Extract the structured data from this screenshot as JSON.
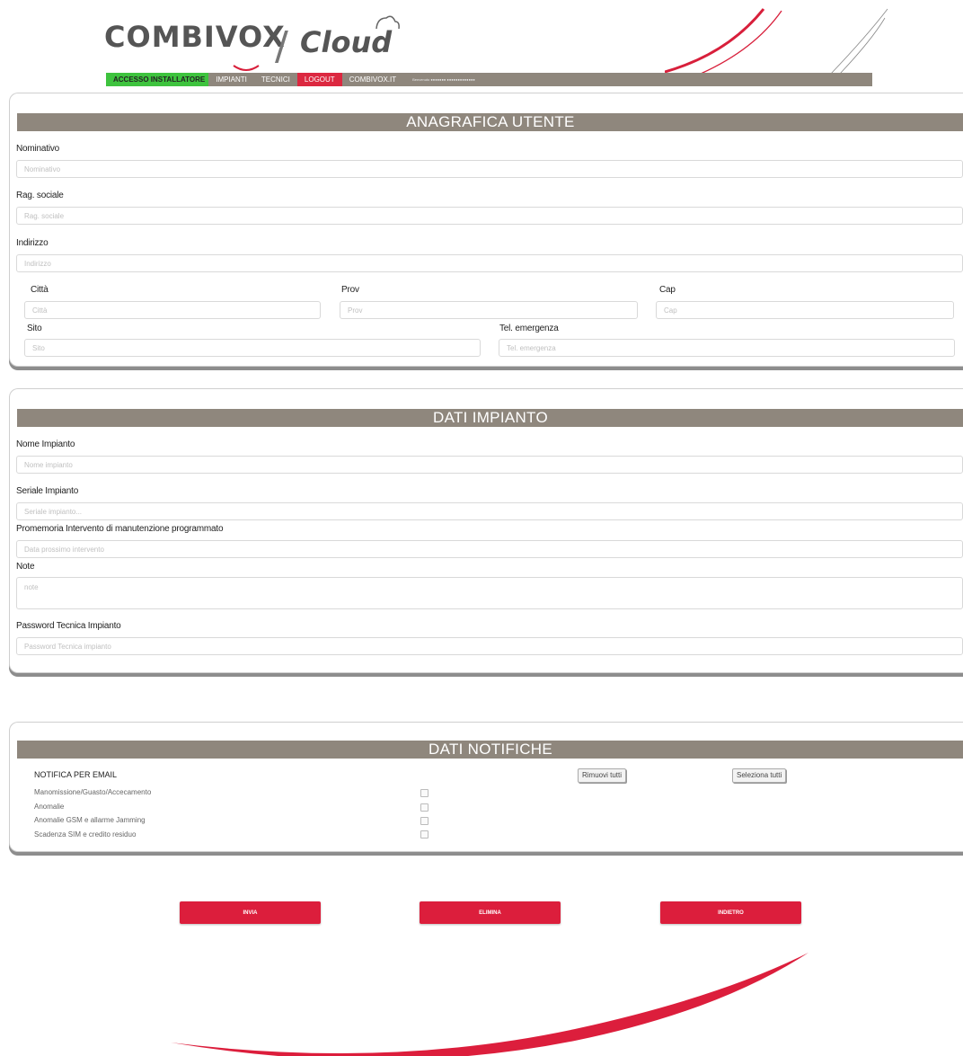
{
  "logo": {
    "brand": "COMBIVOX",
    "separator": "/",
    "product": "Cloud"
  },
  "nav": {
    "items": [
      {
        "label": "ACCESSO INSTALLATORE"
      },
      {
        "label": "IMPIANTI"
      },
      {
        "label": "TECNICI"
      },
      {
        "label": "LOGOUT"
      },
      {
        "label": "COMBIVOX.IT"
      }
    ],
    "info": "Benvenuto  ●●●●●●●  ●●●●●●●●●●●●●"
  },
  "anagrafica": {
    "title": "ANAGRAFICA UTENTE",
    "nominativo": {
      "label": "Nominativo",
      "placeholder": "Nominativo"
    },
    "rag_sociale": {
      "label": "Rag. sociale",
      "placeholder": "Rag. sociale"
    },
    "indirizzo": {
      "label": "Indirizzo",
      "placeholder": "Indirizzo"
    },
    "citta": {
      "label": "Città",
      "placeholder": "Città"
    },
    "prov": {
      "label": "Prov",
      "placeholder": "Prov"
    },
    "cap": {
      "label": "Cap",
      "placeholder": "Cap"
    },
    "sito": {
      "label": "Sito",
      "placeholder": "Sito"
    },
    "tel_emergenza": {
      "label": "Tel. emergenza",
      "placeholder": "Tel. emergenza"
    }
  },
  "impianto": {
    "title": "DATI IMPIANTO",
    "nome": {
      "label": "Nome Impianto",
      "placeholder": "Nome impianto"
    },
    "seriale": {
      "label": "Seriale Impianto",
      "placeholder": "Seriale impianto..."
    },
    "promemoria": {
      "label": "Promemoria Intervento di manutenzione programmato",
      "placeholder": "Data prossimo intervento"
    },
    "note": {
      "label": "Note",
      "placeholder": "note"
    },
    "password": {
      "label": "Password Tecnica Impianto",
      "placeholder": "Password Tecnica impianto"
    }
  },
  "notifiche": {
    "title": "DATI NOTIFICHE",
    "email_title": "NOTIFICA PER EMAIL",
    "remove_all": "Rimuovi tutti",
    "select_all": "Seleziona tutti",
    "items": [
      {
        "label": "Manomissione/Guasto/Accecamento",
        "checked": false
      },
      {
        "label": "Anomalie",
        "checked": false
      },
      {
        "label": "Anomalie GSM e allarme Jamming",
        "checked": false
      },
      {
        "label": "Scadenza SIM e credito residuo",
        "checked": false
      }
    ]
  },
  "actions": {
    "send": "INVIA",
    "delete": "ELIMINA",
    "back": "INDIETRO"
  },
  "colors": {
    "accent": "#dc1e3c",
    "header_bar": "#8f877d",
    "active_nav": "#3ec33e"
  }
}
